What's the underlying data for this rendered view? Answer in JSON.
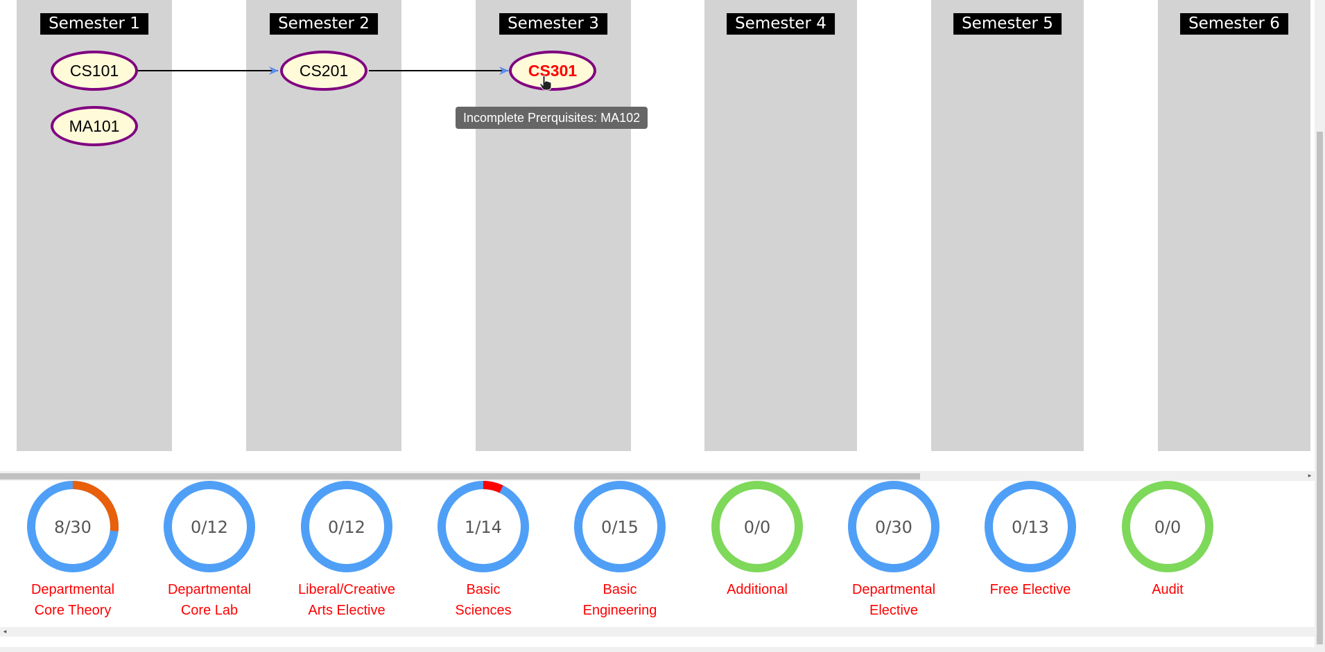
{
  "semesters": [
    {
      "title": "Semester 1",
      "courses": [
        "CS101",
        "MA101"
      ]
    },
    {
      "title": "Semester 2",
      "courses": [
        "CS201"
      ]
    },
    {
      "title": "Semester 3",
      "courses": [
        "CS301"
      ]
    },
    {
      "title": "Semester 4",
      "courses": []
    },
    {
      "title": "Semester 5",
      "courses": []
    },
    {
      "title": "Semester 6",
      "courses": []
    }
  ],
  "prerequisite_links": [
    {
      "from": "CS101",
      "to": "CS201"
    },
    {
      "from": "CS201",
      "to": "CS301"
    }
  ],
  "incomplete_course": "CS301",
  "tooltip": {
    "text": "Incomplete Prerquisites: MA102"
  },
  "progress": [
    {
      "value": "8/30",
      "done": 8,
      "total": 30,
      "line1": "Departmental",
      "line2": "Core Theory",
      "arc_color": "#e8600c"
    },
    {
      "value": "0/12",
      "done": 0,
      "total": 12,
      "line1": "Departmental",
      "line2": "Core Lab",
      "arc_color": "#4f9ff7"
    },
    {
      "value": "0/12",
      "done": 0,
      "total": 12,
      "line1": "Liberal/Creative",
      "line2": "Arts Elective",
      "arc_color": "#4f9ff7"
    },
    {
      "value": "1/14",
      "done": 1,
      "total": 14,
      "line1": "Basic",
      "line2": "Sciences",
      "arc_color": "#ff0000"
    },
    {
      "value": "0/15",
      "done": 0,
      "total": 15,
      "line1": "Basic",
      "line2": "Engineering",
      "arc_color": "#4f9ff7"
    },
    {
      "value": "0/0",
      "done": 0,
      "total": 0,
      "line1": "Additional",
      "line2": "",
      "arc_color": "#7ed85a"
    },
    {
      "value": "0/30",
      "done": 0,
      "total": 30,
      "line1": "Departmental",
      "line2": "Elective",
      "arc_color": "#4f9ff7"
    },
    {
      "value": "0/13",
      "done": 0,
      "total": 13,
      "line1": "Free Elective",
      "line2": "",
      "arc_color": "#4f9ff7"
    },
    {
      "value": "0/0",
      "done": 0,
      "total": 0,
      "line1": "Audit",
      "line2": "",
      "arc_color": "#7ed85a"
    }
  ],
  "colors": {
    "ring_pending": "#4f9ff7",
    "ring_empty_category": "#7ed85a",
    "node_border": "#800080",
    "node_fill": "#fffbd9",
    "label_red": "#ff0000"
  },
  "icons": {
    "scroll_left": "◂",
    "scroll_right": "▸"
  }
}
